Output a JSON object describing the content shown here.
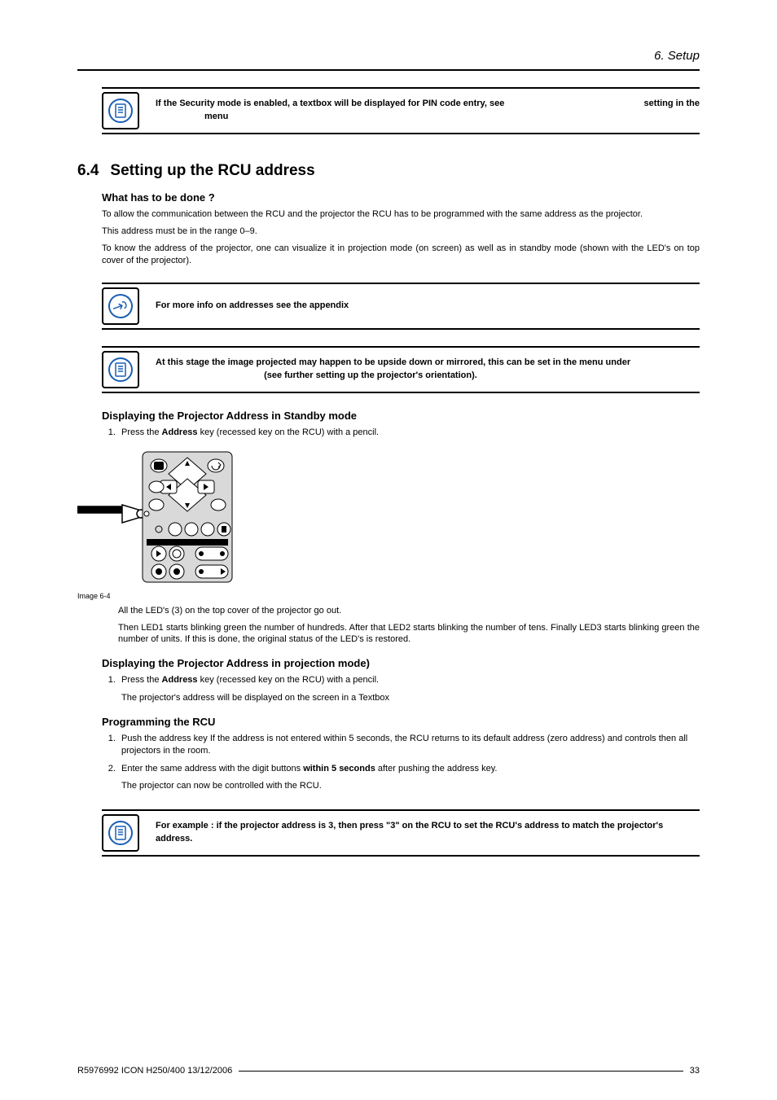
{
  "header": {
    "running": "6.  Setup"
  },
  "callout1": {
    "text_a": "If the Security mode is enabled, a textbox will be displayed for PIN code entry, see",
    "text_b": "setting in the",
    "text_c": "menu"
  },
  "section": {
    "num": "6.4",
    "title": "Setting up the RCU address"
  },
  "what": {
    "heading": "What has to be done ?",
    "p1": "To allow the communication between the RCU and the projector the RCU has to be programmed with the same address as the projector.",
    "p2": "This address must be in the range 0–9.",
    "p3": "To know the address of the projector, one can visualize it in projection mode (on screen) as well as in standby mode (shown with the LED's on top cover of the projector)."
  },
  "callout2": {
    "text": "For more info on addresses see the appendix"
  },
  "callout3": {
    "text_a": "At this stage the image projected may happen to be upside down or mirrored, this can be set in the menu under",
    "text_b": "(see further setting up the projector's orientation)."
  },
  "disp_standby": {
    "heading": "Displaying the Projector Address in Standby mode",
    "step1_a": "Press the ",
    "step1_b": "Address",
    "step1_c": " key (recessed key on the RCU) with a pencil.",
    "caption": "Image 6-4",
    "after1": "All the LED's (3) on the top cover of the projector go out.",
    "after2": "Then LED1 starts blinking green the number of hundreds.  After that LED2 starts blinking the number of tens.  Finally LED3 starts blinking green the number of units.  If this is done, the original status of the LED's is restored."
  },
  "disp_proj": {
    "heading": "Displaying the Projector Address in projection mode)",
    "step1_a": "Press the ",
    "step1_b": "Address",
    "step1_c": " key (recessed key on the RCU) with a pencil.",
    "step1_sub": "The projector's address will be displayed on the screen in a Textbox"
  },
  "prog": {
    "heading": "Programming the RCU",
    "step1": "Push the address key If the address is not entered within 5 seconds, the RCU returns to its default address (zero address) and controls then all projectors in the room.",
    "step2_a": "Enter the same address with the digit buttons ",
    "step2_b": "within 5 seconds",
    "step2_c": " after pushing the address key.",
    "step2_sub": "The projector can now be controlled with the RCU."
  },
  "callout4": {
    "text": "For example : if the projector address is 3, then press \"3\" on the RCU to set the RCU's address to match the projector's address."
  },
  "footer": {
    "left": "R5976992  ICON H250/400  13/12/2006",
    "right": "33"
  }
}
